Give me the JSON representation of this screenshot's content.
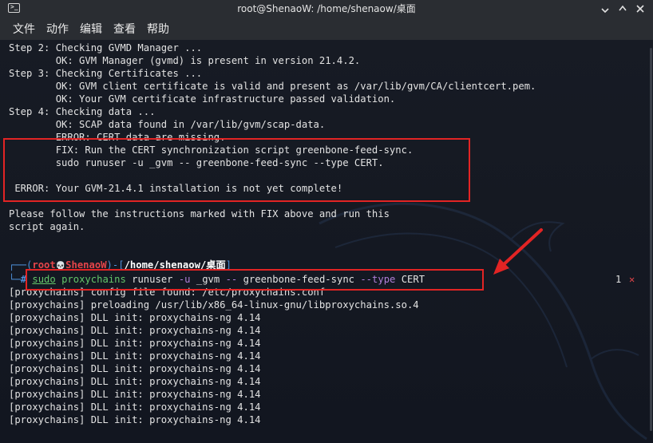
{
  "window": {
    "title": "root@ShenaoW: /home/shenaow/桌面",
    "icon": "terminal-icon",
    "buttons": [
      "minimize-icon",
      "maximize-icon",
      "close-icon"
    ]
  },
  "menu": [
    "文件",
    "动作",
    "编辑",
    "查看",
    "帮助"
  ],
  "output_top": [
    "Step 2: Checking GVMD Manager ...",
    "        OK: GVM Manager (gvmd) is present in version 21.4.2.",
    "Step 3: Checking Certificates ...",
    "        OK: GVM client certificate is valid and present as /var/lib/gvm/CA/clientcert.pem.",
    "        OK: Your GVM certificate infrastructure passed validation.",
    "Step 4: Checking data ...",
    "        OK: SCAP data found in /var/lib/gvm/scap-data.",
    "        ERROR: CERT data are missing.",
    "        FIX: Run the CERT synchronization script greenbone-feed-sync.",
    "        sudo runuser -u _gvm -- greenbone-feed-sync --type CERT.",
    "",
    " ERROR: Your GVM-21.4.1 installation is not yet complete!",
    "",
    "Please follow the instructions marked with FIX above and run this",
    "script again."
  ],
  "prompt": {
    "user": "root",
    "skull": "💀",
    "host": "ShenaoW",
    "path": "/home/shenaow/桌面"
  },
  "command": {
    "sudo": "sudo",
    "program": "proxychains",
    "args_a": " runuser ",
    "flag_u": "-u",
    "args_b": " _gvm ",
    "dashdash": "--",
    "args_c": " greenbone-feed-sync ",
    "flag_type": "--type",
    "args_d": " CERT"
  },
  "right_status": {
    "count": "1",
    "mark": "✕"
  },
  "output_bottom": [
    "[proxychains] config file found: /etc/proxychains.conf",
    "[proxychains] preloading /usr/lib/x86_64-linux-gnu/libproxychains.so.4",
    "[proxychains] DLL init: proxychains-ng 4.14",
    "[proxychains] DLL init: proxychains-ng 4.14",
    "[proxychains] DLL init: proxychains-ng 4.14",
    "[proxychains] DLL init: proxychains-ng 4.14",
    "[proxychains] DLL init: proxychains-ng 4.14",
    "[proxychains] DLL init: proxychains-ng 4.14",
    "[proxychains] DLL init: proxychains-ng 4.14",
    "[proxychains] DLL init: proxychains-ng 4.14",
    "[proxychains] DLL init: proxychains-ng 4.14"
  ],
  "colors": {
    "annotation": "#e22424",
    "prompt_blue": "#4e8fd8",
    "prompt_red": "#e5454a",
    "cmd_green": "#63c66a",
    "flag_purple": "#b07fd8"
  }
}
